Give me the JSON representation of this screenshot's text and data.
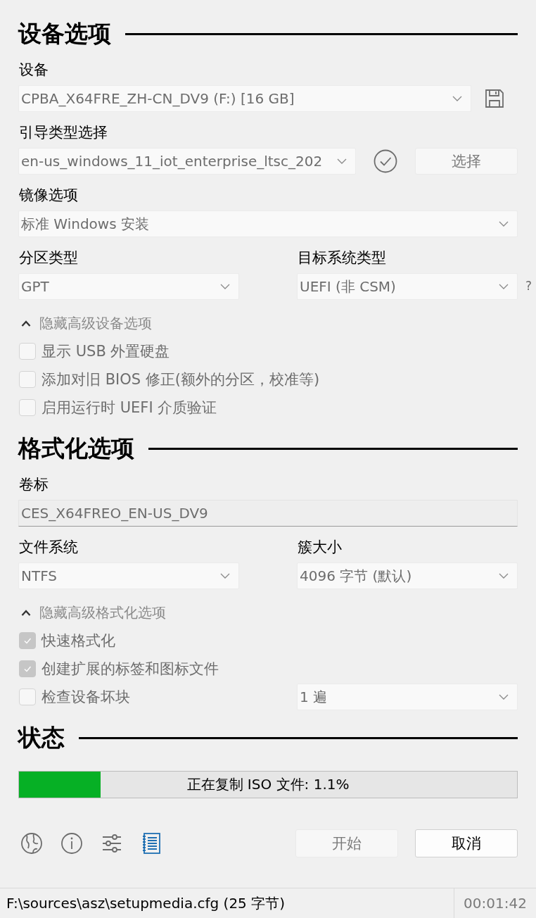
{
  "sections": [
    {
      "title": "设备选项",
      "rows": [
        {
          "kind": "select_save",
          "label": "设备",
          "value": "CPBA_X64FRE_ZH-CN_DV9 (F:) [16 GB]",
          "disabled": true
        },
        {
          "kind": "select_check_button",
          "label": "引导类型选择",
          "value": "en-us_windows_11_iot_enterprise_ltsc_202",
          "disabled": true,
          "button": {
            "label": "选择",
            "disabled": true
          }
        },
        {
          "kind": "select",
          "label": "镜像选项",
          "value": "标准 Windows 安装",
          "disabled": true
        },
        {
          "kind": "select_pair",
          "fields": [
            {
              "label": "分区类型",
              "value": "GPT",
              "disabled": true
            },
            {
              "label": "目标系统类型",
              "value": "UEFI (非 CSM)",
              "disabled": true,
              "help": "?"
            }
          ]
        },
        {
          "kind": "toggle",
          "label": "隐藏高级设备选项",
          "expanded": true
        },
        {
          "kind": "checkbox",
          "label": "显示 USB 外置硬盘",
          "checked": false,
          "disabled": true
        },
        {
          "kind": "checkbox",
          "label": "添加对旧 BIOS 修正(额外的分区，校准等)",
          "checked": false,
          "disabled": true
        },
        {
          "kind": "checkbox",
          "label": "启用运行时 UEFI 介质验证",
          "checked": false,
          "disabled": true
        }
      ]
    },
    {
      "title": "格式化选项",
      "rows": [
        {
          "kind": "text_field",
          "label": "卷标",
          "value": "CES_X64FREO_EN-US_DV9",
          "disabled": true
        },
        {
          "kind": "select_pair",
          "fields": [
            {
              "label": "文件系统",
              "value": "NTFS",
              "disabled": true
            },
            {
              "label": "簇大小",
              "value": "4096 字节 (默认)",
              "disabled": true
            }
          ]
        },
        {
          "kind": "toggle",
          "label": "隐藏高级格式化选项",
          "expanded": true
        },
        {
          "kind": "checkbox",
          "label": "快速格式化",
          "checked": true,
          "disabled": true
        },
        {
          "kind": "checkbox",
          "label": "创建扩展的标签和图标文件",
          "checked": true,
          "disabled": true
        },
        {
          "kind": "checkbox_select",
          "label": "检查设备坏块",
          "checked": false,
          "disabled": true,
          "select": {
            "value": "1 遍",
            "disabled": true
          }
        }
      ]
    },
    {
      "title": "状态",
      "rows": [
        {
          "kind": "progress",
          "text": "正在复制 ISO 文件: 1.1%",
          "level": 0.164
        }
      ]
    }
  ],
  "buttons": [
    {
      "label": "开始",
      "disabled": true
    },
    {
      "label": "取消",
      "disabled": false
    }
  ],
  "status_bar": {
    "message": "F:\\sources\\asz\\setupmedia.cfg (25 字节)",
    "timer": "00:01:42"
  }
}
